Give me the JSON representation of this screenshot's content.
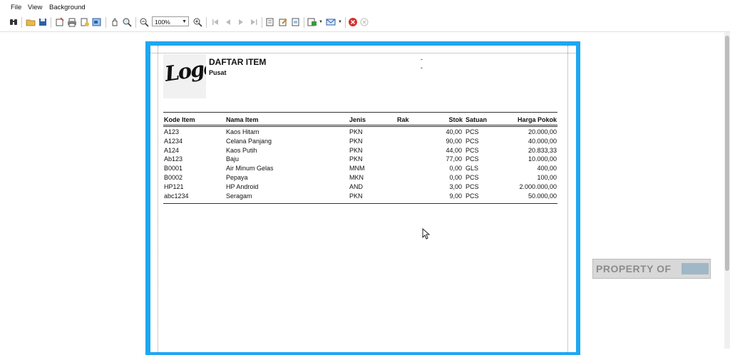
{
  "menu": {
    "file": "File",
    "view": "View",
    "background": "Background"
  },
  "toolbar": {
    "zoom_value": "100%"
  },
  "report": {
    "logo_text": "Logo",
    "title": "DAFTAR ITEM",
    "subtitle": "Pusat",
    "dash1": "-",
    "dash2": "-",
    "headers": {
      "kode": "Kode Item",
      "nama": "Nama Item",
      "jenis": "Jenis",
      "rak": "Rak",
      "stok": "Stok",
      "satuan": "Satuan",
      "harga": "Harga Pokok"
    },
    "rows": [
      {
        "kode": "A123",
        "nama": "Kaos Hitam",
        "jenis": "PKN",
        "stok": "40,00",
        "satuan": "PCS",
        "harga": "20.000,00"
      },
      {
        "kode": "A1234",
        "nama": "Celana Panjang",
        "jenis": "PKN",
        "stok": "90,00",
        "satuan": "PCS",
        "harga": "40.000,00"
      },
      {
        "kode": "A124",
        "nama": "Kaos Putih",
        "jenis": "PKN",
        "stok": "44,00",
        "satuan": "PCS",
        "harga": "20.833,33"
      },
      {
        "kode": "Ab123",
        "nama": "Baju",
        "jenis": "PKN",
        "stok": "77,00",
        "satuan": "PCS",
        "harga": "10.000,00"
      },
      {
        "kode": "B0001",
        "nama": "Air Minum Gelas",
        "jenis": "MNM",
        "stok": "0,00",
        "satuan": "GLS",
        "harga": "400,00"
      },
      {
        "kode": "B0002",
        "nama": "Pepaya",
        "jenis": "MKN",
        "stok": "0,00",
        "satuan": "PCS",
        "harga": "100,00"
      },
      {
        "kode": "HP121",
        "nama": "HP Android",
        "jenis": "AND",
        "stok": "3,00",
        "satuan": "PCS",
        "harga": "2.000.000,00"
      },
      {
        "kode": "abc1234",
        "nama": "Seragam",
        "jenis": "PKN",
        "stok": "9,00",
        "satuan": "PCS",
        "harga": "50.000,00"
      }
    ]
  },
  "watermark": {
    "text": "PROPERTY OF"
  },
  "colors": {
    "page_frame": "#1ea7f2",
    "close_red": "#d9302c"
  }
}
